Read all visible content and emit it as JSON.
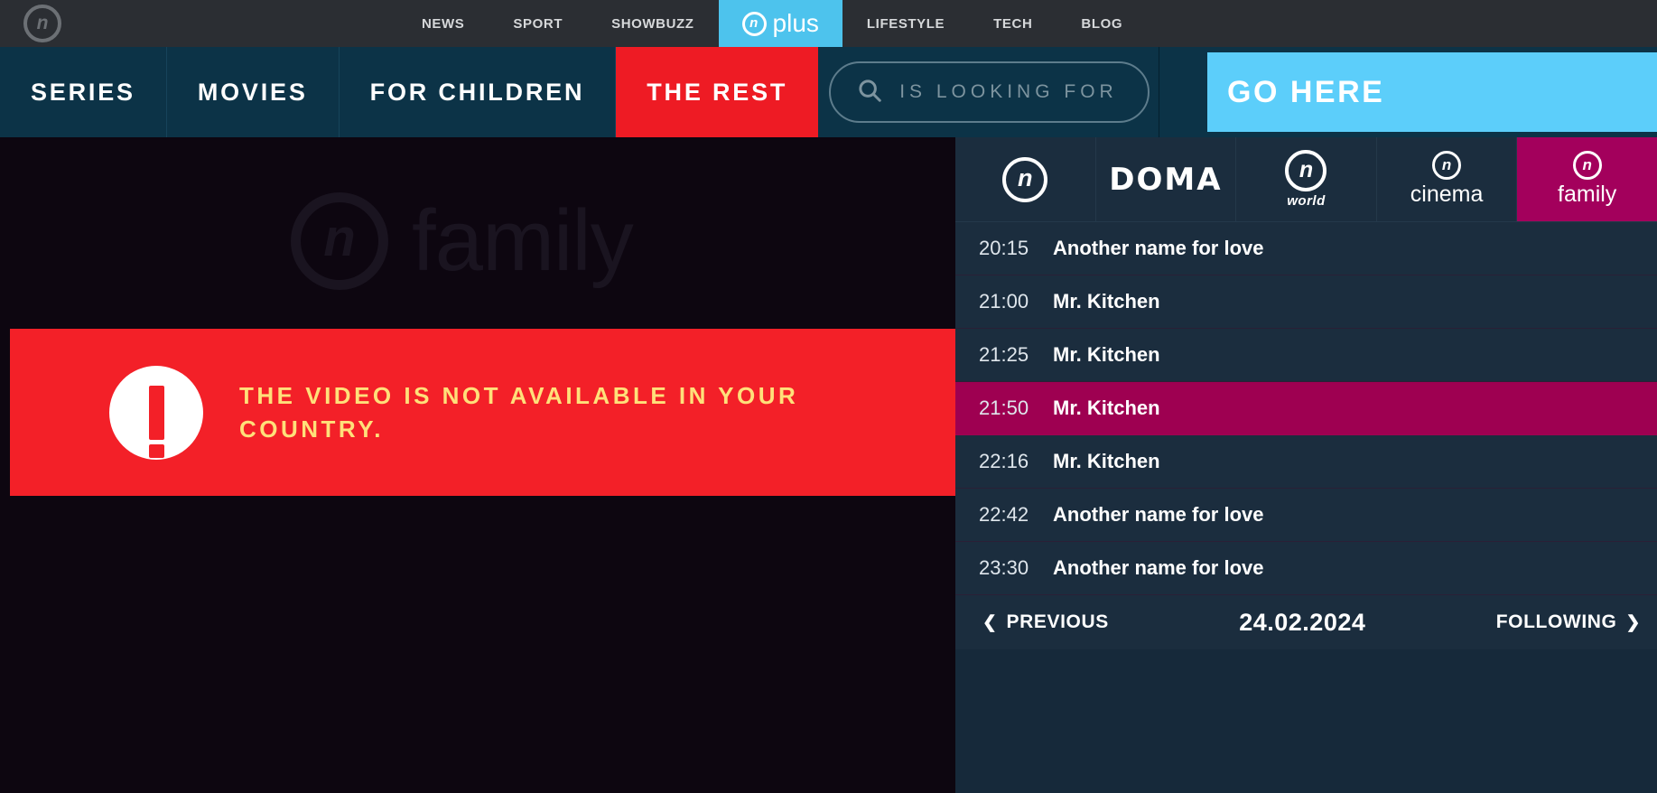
{
  "topbar": {
    "logo_icon": "n-circle-logo",
    "items": [
      {
        "label": "NEWS",
        "active": false
      },
      {
        "label": "SPORT",
        "active": false
      },
      {
        "label": "SHOWBUZZ",
        "active": false
      },
      {
        "label": "plus",
        "active": true
      },
      {
        "label": "LIFESTYLE",
        "active": false
      },
      {
        "label": "TECH",
        "active": false
      },
      {
        "label": "BLOG",
        "active": false
      }
    ],
    "background": "#2b2e33",
    "active_color": "#4dc3ed"
  },
  "subbar": {
    "items": [
      {
        "label": "SERIES"
      },
      {
        "label": "MOVIES"
      },
      {
        "label": "FOR CHILDREN"
      },
      {
        "label": "THE REST"
      }
    ],
    "active_label": "THE REST",
    "active_color": "#ee1b24",
    "background": "#0c3347",
    "search": {
      "placeholder": "IS LOOKING FOR",
      "value": "",
      "icon": "search-icon"
    },
    "go_button": {
      "label": "GO HERE",
      "color": "#5ccefa"
    }
  },
  "player": {
    "watermark": {
      "logo_icon": "n-circle-logo",
      "text": "family"
    },
    "alert": {
      "icon": "exclamation-icon",
      "message": "THE VIDEO IS NOT AVAILABLE IN YOUR COUNTRY.",
      "background": "#f32028",
      "text_color": "#ffe07a"
    }
  },
  "epg": {
    "channels": [
      {
        "name": "n",
        "sub": "",
        "style": "logo-only",
        "active": false
      },
      {
        "name": "DOMA",
        "sub": "",
        "style": "wordmark",
        "active": false
      },
      {
        "name": "n",
        "sub": "world",
        "style": "logo-sub",
        "active": false
      },
      {
        "name": "n",
        "sub": "cinema",
        "style": "logo-sub-plain",
        "active": false
      },
      {
        "name": "n",
        "sub": "family",
        "style": "logo-sub-plain",
        "active": true
      }
    ],
    "active_channel_color": "#a3005c",
    "schedule": [
      {
        "time": "20:15",
        "title": "Another name for love",
        "now": false
      },
      {
        "time": "21:00",
        "title": "Mr. Kitchen",
        "now": false
      },
      {
        "time": "21:25",
        "title": "Mr. Kitchen",
        "now": false
      },
      {
        "time": "21:50",
        "title": "Mr. Kitchen",
        "now": true
      },
      {
        "time": "22:16",
        "title": "Mr. Kitchen",
        "now": false
      },
      {
        "time": "22:42",
        "title": "Another name for love",
        "now": false
      },
      {
        "time": "23:30",
        "title": "Another name for love",
        "now": false
      }
    ],
    "now_playing_color": "#9e0051",
    "footer": {
      "previous_label": "PREVIOUS",
      "previous_icon": "chevron-left-icon",
      "date": "24.02.2024",
      "following_label": "FOLLOWING",
      "following_icon": "chevron-right-icon"
    }
  }
}
